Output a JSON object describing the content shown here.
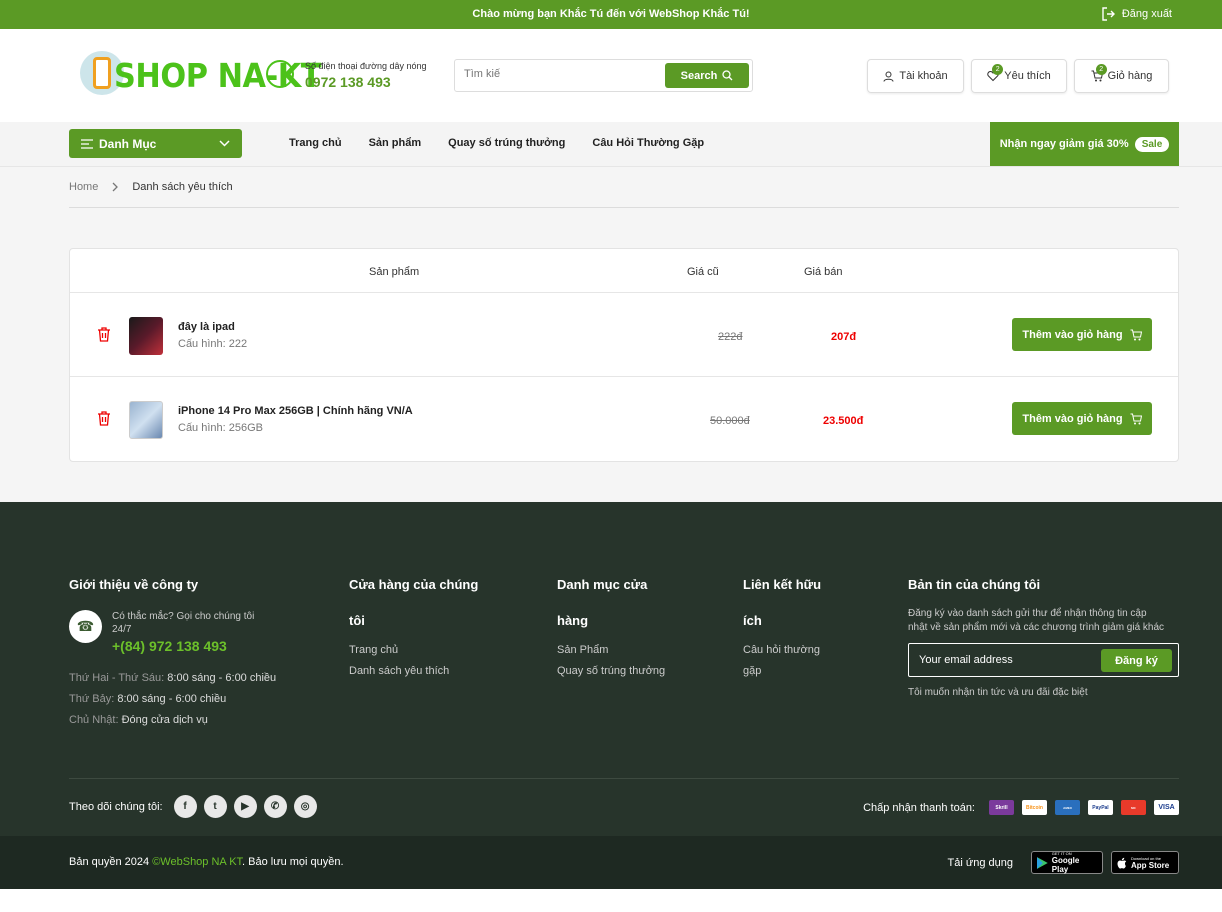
{
  "topbar": {
    "welcome": "Chào mừng bạn Khắc Tú đến với WebShop Khắc Tú!",
    "logout": "Đăng xuất"
  },
  "header": {
    "logo_text": "SHOP NA-KT",
    "hotline_label": "Số điện thoại đường dây nóng",
    "hotline_number": "0972 138 493",
    "search_placeholder": "Tìm kiế",
    "search_button": "Search",
    "account": "Tài khoản",
    "wishlist": "Yêu thích",
    "wishlist_count": "2",
    "cart": "Giỏ hàng",
    "cart_count": "2"
  },
  "nav": {
    "category": "Danh Mục",
    "links": [
      "Trang chủ",
      "Sản phẩm",
      "Quay số trúng thưởng",
      "Câu Hỏi Thường Gặp"
    ],
    "promo": "Nhận ngay giảm giá 30%",
    "promo_badge": "Sale"
  },
  "breadcrumb": {
    "home": "Home",
    "current": "Danh sách yêu thích"
  },
  "wishlist_table": {
    "headers": {
      "product": "Sản phẩm",
      "old_price": "Giá cũ",
      "price": "Giá bán"
    },
    "items": [
      {
        "name": "đây là ipad",
        "config": "Cấu hình: 222",
        "old_price": "222đ",
        "price": "207đ",
        "button": "Thêm vào giỏ hàng"
      },
      {
        "name": "iPhone 14 Pro Max 256GB | Chính hãng VN/A",
        "config": "Cấu hình: 256GB",
        "old_price": "50.000đ",
        "price": "23.500đ",
        "button": "Thêm vào giỏ hàng"
      }
    ]
  },
  "footer": {
    "about": {
      "title": "Giới thiệu về công ty",
      "question": "Có thắc mắc? Gọi cho chúng tôi 24/7",
      "phone": "+(84) 972 138 493",
      "hours": [
        {
          "day": "Thứ Hai - Thứ Sáu:",
          "time": "8:00 sáng - 6:00 chiều"
        },
        {
          "day": "Thứ Bảy:",
          "time": "8:00 sáng - 6:00 chiều"
        },
        {
          "day": "Chủ Nhật:",
          "time": "Đóng cửa dịch vụ"
        }
      ]
    },
    "store": {
      "title": "Cửa hàng của chúng tôi",
      "links": [
        "Trang chủ",
        "Danh sách yêu thích"
      ]
    },
    "categories": {
      "title": "Danh mục cửa hàng",
      "links": [
        "Sản Phẩm",
        "Quay số trúng thưởng"
      ]
    },
    "useful": {
      "title": "Liên kết hữu ích",
      "links": [
        "Câu hỏi thường gặp"
      ]
    },
    "newsletter": {
      "title": "Bản tin của chúng tôi",
      "text": "Đăng ký vào danh sách gửi thư để nhận thông tin cập nhật về sản phẩm mới và các chương trình giảm giá khác",
      "placeholder": "Your email address",
      "button": "Đăng ký",
      "note": "Tôi muốn nhận tin tức và ưu đãi đặc biệt"
    },
    "follow": "Theo dõi chúng tôi:",
    "social": [
      "facebook-icon",
      "twitter-icon",
      "youtube-icon",
      "whatsapp-icon",
      "instagram-icon"
    ],
    "payment_label": "Chấp nhận thanh toán:",
    "payments": [
      "Skrill",
      "Bitcoin",
      "American Express",
      "PayPal",
      "MasterCard",
      "VISA"
    ],
    "copyright_pre": "Bản quyền 2024",
    "copyright_brand": "©WebShop NA KT",
    "copyright_post": ". Bảo lưu mọi quyền.",
    "app_label": "Tải ứng dụng",
    "google_play_small": "GET IT ON",
    "google_play": "Google Play",
    "app_store_small": "Download on the",
    "app_store": "App Store"
  },
  "colors": {
    "accent": "#5b9a25",
    "footer": "#27342b",
    "price": "#e00000"
  }
}
